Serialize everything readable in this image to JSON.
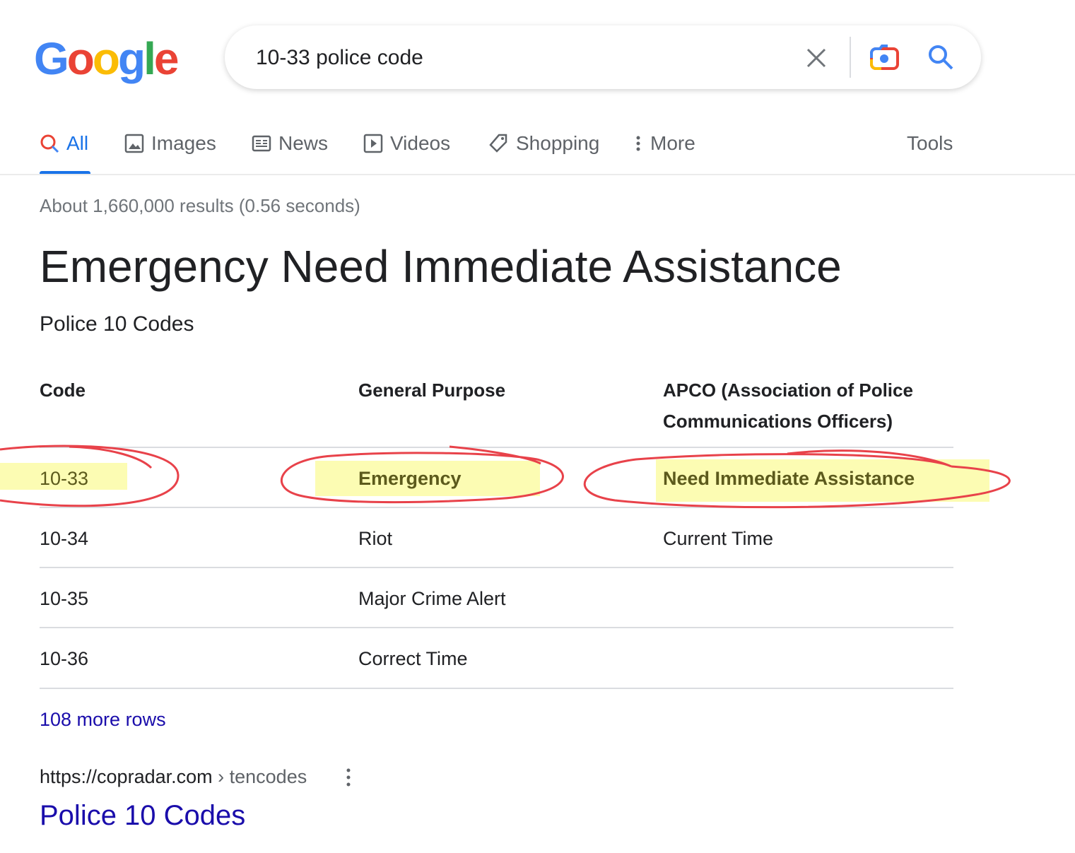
{
  "logo": "Google",
  "search": {
    "query": "10-33 police code"
  },
  "tabs": [
    {
      "label": "All",
      "icon": "search-icon",
      "active": true
    },
    {
      "label": "Images",
      "icon": "image-icon"
    },
    {
      "label": "News",
      "icon": "news-icon"
    },
    {
      "label": "Videos",
      "icon": "video-icon"
    },
    {
      "label": "Shopping",
      "icon": "tag-icon"
    },
    {
      "label": "More",
      "icon": "more-vert-icon"
    }
  ],
  "tools_label": "Tools",
  "result_stats": "About 1,660,000 results (0.56 seconds)",
  "featured": {
    "title": "Emergency Need Immediate Assistance",
    "subtitle": "Police 10 Codes",
    "table": {
      "headers": [
        "Code",
        "General Purpose",
        "APCO (Association of Police",
        "Communications Officers)"
      ],
      "rows": [
        [
          "10-33",
          "Emergency",
          "Need Immediate Assistance"
        ],
        [
          "10-34",
          "Riot",
          "Current Time"
        ],
        [
          "10-35",
          "Major Crime Alert",
          ""
        ],
        [
          "10-36",
          "Correct Time",
          ""
        ]
      ]
    },
    "more_rows": "108 more rows"
  },
  "source": {
    "url": "https://copradar.com",
    "path": "› tencodes",
    "title": "Police 10 Codes"
  },
  "colors": {
    "accent": "#1a73e8",
    "link": "#1a0dab",
    "annotation_red": "#e8424a",
    "highlight": "#fbfb9a"
  }
}
